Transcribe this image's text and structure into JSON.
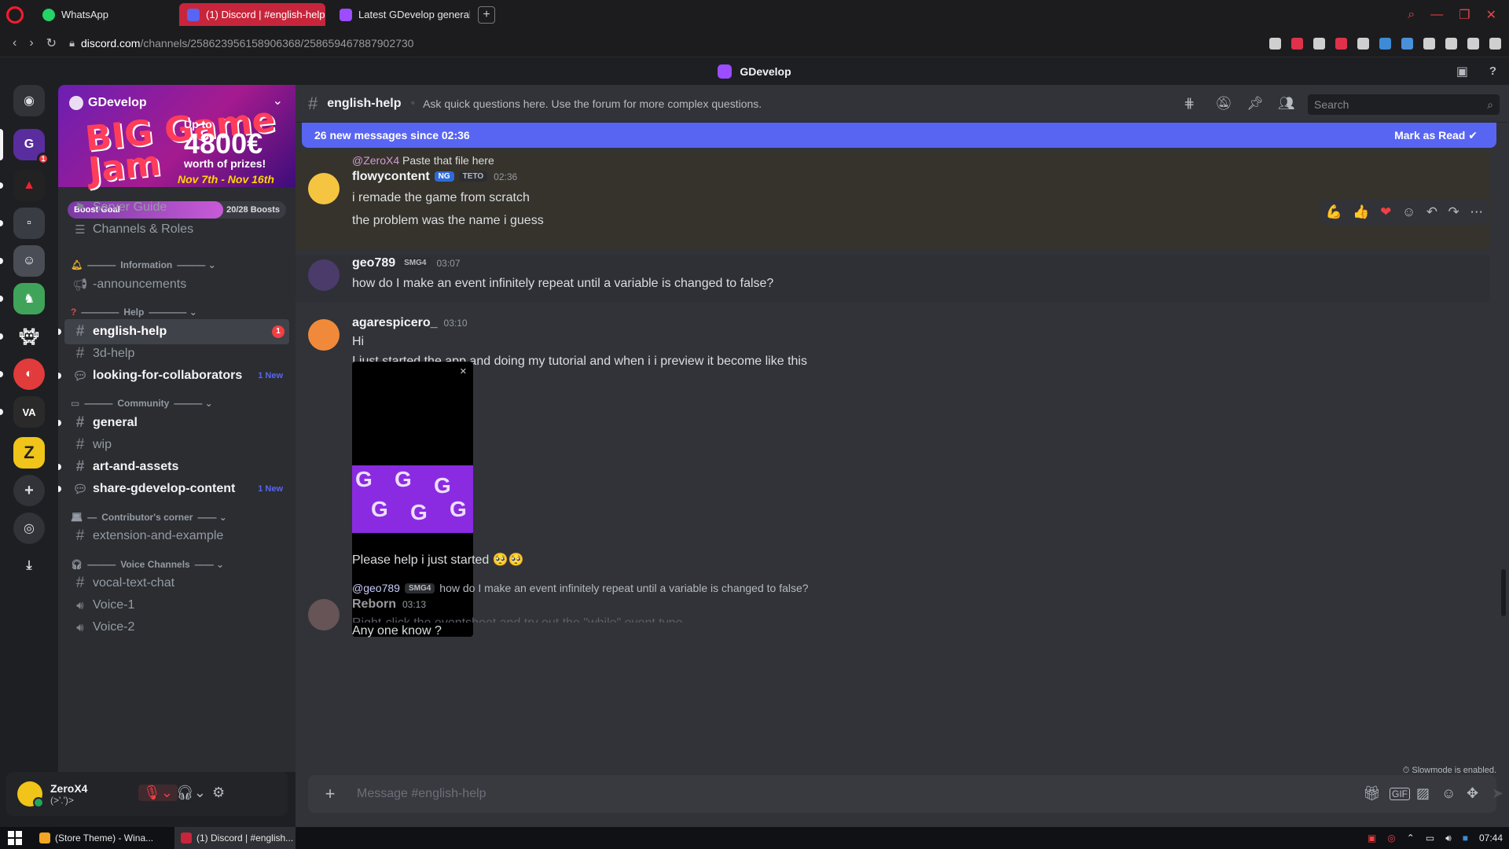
{
  "browser": {
    "tabs": [
      {
        "label": "WhatsApp",
        "icon": "whatsapp-icon",
        "color": "#25d366"
      },
      {
        "label": "(1) Discord | #english-help",
        "icon": "discord-icon",
        "color": "#5865f2"
      },
      {
        "label": "Latest GDevelop general t",
        "icon": "gdevelop-icon",
        "color": "#9b4dff"
      }
    ],
    "new_tab": "+",
    "url_host": "discord.com",
    "url_path": "/channels/258623956158906368/258659467887902730"
  },
  "app": {
    "title": "GDevelop"
  },
  "server": {
    "name": "GDevelop",
    "banner_big": "BIG Game Jam",
    "banner_prize_pre": "Up to",
    "banner_prize": "4800€",
    "banner_prize_post": "worth of prizes!",
    "banner_dates": "Nov 7th - Nov 16th",
    "boost_label": "Boost Goal",
    "boost_count": "20/28 Boosts",
    "boost_fraction": 0.714
  },
  "sidebar": {
    "server_guide": "Server Guide",
    "channels_roles": "Channels & Roles",
    "categories": {
      "information": "Information",
      "help": "Help",
      "community": "Community",
      "contributors": "Contributor's corner",
      "voice": "Voice Channels"
    },
    "channels": {
      "announcements": "-announcements",
      "english_help": "english-help",
      "english_help_badge": "1",
      "three_d_help": "3d-help",
      "looking": "looking-for-collaborators",
      "looking_new": "1 New",
      "general": "general",
      "wip": "wip",
      "art": "art-and-assets",
      "share": "share-gdevelop-content",
      "share_new": "1 New",
      "extension": "extension-and-example",
      "vocal_text": "vocal-text-chat",
      "voice1": "Voice-1",
      "voice2": "Voice-2"
    }
  },
  "user": {
    "name": "ZeroX4",
    "status": "(>'.')>"
  },
  "channel": {
    "name": "english-help",
    "topic": "Ask quick questions here. Use the forum for more complex questions.",
    "search_placeholder": "Search",
    "new_messages": "26 new messages since 02:36",
    "mark_read": "Mark as Read",
    "composer_placeholder": "Message #english-help",
    "slowmode": "Slowmode is enabled."
  },
  "messages": [
    {
      "reply_to": "@ZeroX4",
      "reply_text": "Paste that file here",
      "author": "flowycontent",
      "tag": "NG",
      "tag2": "TETO",
      "time": "02:36",
      "lines": [
        "i remade the game from scratch",
        "the problem was the name i guess"
      ],
      "avatar_color": "#f5c542"
    },
    {
      "author": "geo789",
      "tag": "SMG4",
      "time": "03:07",
      "lines": [
        "how do I make an event infinitely repeat until a variable is changed to false?"
      ],
      "avatar_color": "#4b3b6a"
    },
    {
      "author": "agarespicero_",
      "time": "03:10",
      "lines": [
        "Hi",
        "I just started the app and doing my tutorial and when i  i preview it become like this",
        "Any one know ?",
        "Please help i just started 🥺🥺"
      ],
      "avatar_color": "#f08a3a"
    },
    {
      "reply_to": "@geo789",
      "reply_tag": "SMG4",
      "reply_text": "how do I make an event infinitely repeat until a variable is changed to false?",
      "author": "Reborn",
      "time": "03:13",
      "lines": [
        "Right-click the eventsheet and try out the \"while\" event type"
      ],
      "avatar_color": "#8a6a6a"
    }
  ],
  "taskbar": {
    "tasks": [
      {
        "label": "(Store Theme) - Wina...",
        "color": "#f5a623"
      },
      {
        "label": "(1) Discord | #english...",
        "color": "#c7253b"
      }
    ],
    "time": "07:44"
  }
}
